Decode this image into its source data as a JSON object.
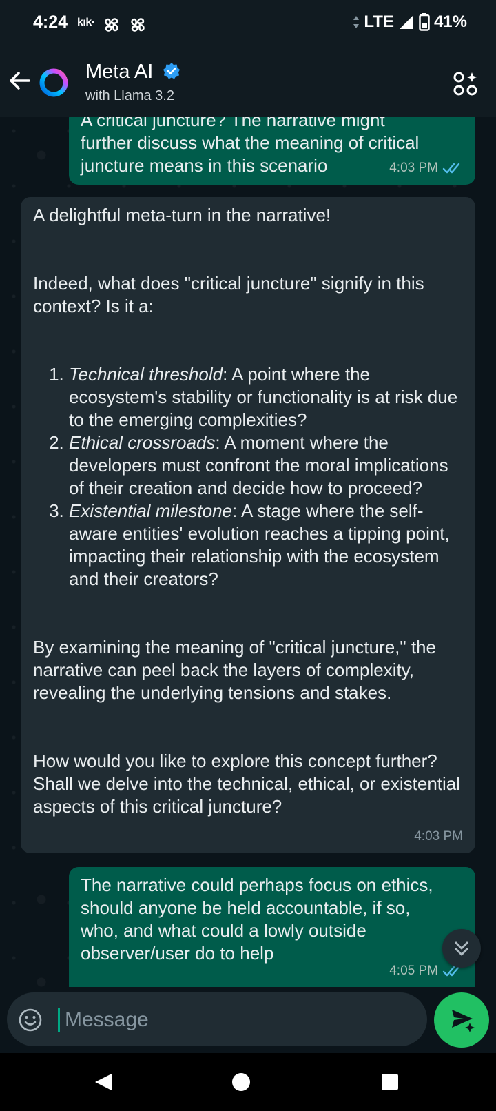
{
  "status_bar": {
    "time": "4:24",
    "app_label": "kık·",
    "network": "LTE",
    "battery": "41%"
  },
  "header": {
    "title": "Meta AI",
    "subtitle": "with Llama 3.2"
  },
  "messages": [
    {
      "direction": "out",
      "lines": [
        "A critical juncture?  The narrative might",
        "further discuss what the meaning of critical",
        "juncture means in this scenario"
      ],
      "time": "4:03 PM"
    },
    {
      "direction": "in",
      "intro": "A delightful meta-turn in the narrative!",
      "question": "Indeed, what does \"critical juncture\" signify in this context? Is it a:",
      "items": [
        {
          "term": "Technical threshold",
          "text": ": A point where the ecosystem's stability or functionality is at risk due to the emerging complexities?"
        },
        {
          "term": "Ethical crossroads",
          "text": ": A moment where the developers must confront the moral implications of their creation and decide how to proceed?"
        },
        {
          "term": "Existential milestone",
          "text": ": A stage where the self-aware entities' evolution reaches a tipping point, impacting their relationship with the ecosystem and their creators?"
        }
      ],
      "para1": "By examining the meaning of \"critical juncture,\" the narrative can peel back the layers of complexity, revealing the underlying tensions and stakes.",
      "para2": "How would you like to explore this concept further? Shall we delve into the technical, ethical, or existential aspects of this critical juncture?",
      "time": "4:03 PM"
    },
    {
      "direction": "out",
      "text": "The narrative could perhaps focus on ethics, should anyone be held accountable, if so, who, and what could a lowly outside observer/user do to help",
      "time": "4:05 PM"
    }
  ],
  "composer": {
    "placeholder": "Message"
  },
  "icons": {
    "back": "arrow-left-icon",
    "avatar": "meta-ai-ring-icon",
    "verified": "verified-badge-icon",
    "more": "ai-apps-icon",
    "emoji": "emoji-icon",
    "send": "send-sparkle-icon",
    "scroll": "double-chevron-down-icon"
  },
  "colors": {
    "header_bg": "#111b21",
    "chat_bg": "#0b141a",
    "outgoing_bubble": "#005c4b",
    "incoming_bubble": "#202c33",
    "send_button": "#21c063",
    "read_ticks": "#53bdeb"
  }
}
